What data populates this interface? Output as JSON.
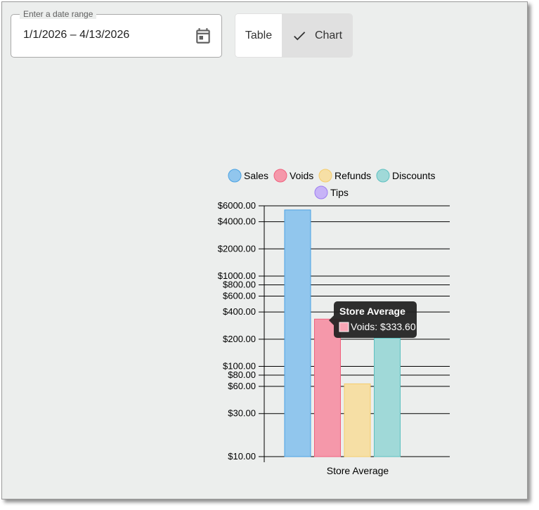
{
  "date_range": {
    "label": "Enter a date range",
    "value": "1/1/2026 – 4/13/2026",
    "icon": "calendar-icon"
  },
  "view_toggle": {
    "table_label": "Table",
    "chart_label": "Chart",
    "selected": "Chart",
    "selected_icon": "check-icon"
  },
  "tooltip": {
    "title": "Store Average",
    "text": "Voids: $333.60",
    "swatch_color": "#f8a6b5"
  },
  "chart_data": {
    "type": "bar",
    "scale": "log",
    "categories": [
      "Store Average"
    ],
    "series": [
      {
        "name": "Sales",
        "values": [
          5400
        ],
        "fill": "#91c6ed",
        "stroke": "#4aa2e3"
      },
      {
        "name": "Voids",
        "values": [
          333.6
        ],
        "fill": "#f598aa",
        "stroke": "#f0607d"
      },
      {
        "name": "Refunds",
        "values": [
          64
        ],
        "fill": "#f6dfa5",
        "stroke": "#f5cc6b"
      },
      {
        "name": "Discounts",
        "values": [
          205
        ],
        "fill": "#a0d9d8",
        "stroke": "#5dc0c0"
      },
      {
        "name": "Tips",
        "values": [
          null
        ],
        "fill": "#c7b3f7",
        "stroke": "#9c7cf0"
      }
    ],
    "y_ticks": [
      {
        "value": 10,
        "label": "$10.00"
      },
      {
        "value": 30,
        "label": "$30.00"
      },
      {
        "value": 60,
        "label": "$60.00"
      },
      {
        "value": 80,
        "label": "$80.00"
      },
      {
        "value": 100,
        "label": "$100.00"
      },
      {
        "value": 200,
        "label": "$200.00"
      },
      {
        "value": 400,
        "label": "$400.00"
      },
      {
        "value": 600,
        "label": "$600.00"
      },
      {
        "value": 800,
        "label": "$800.00"
      },
      {
        "value": 1000,
        "label": "$1000.00"
      },
      {
        "value": 2000,
        "label": "$2000.00"
      },
      {
        "value": 4000,
        "label": "$4000.00"
      },
      {
        "value": 6000,
        "label": "$6000.00"
      }
    ],
    "ylim": [
      10,
      6000
    ],
    "grid": true,
    "legend_position": "top"
  }
}
